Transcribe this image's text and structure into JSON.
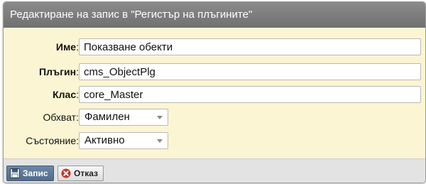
{
  "dialog": {
    "title": "Редактиране на запис в \"Регистър на плъгините\""
  },
  "form": {
    "fields": [
      {
        "label": "Име",
        "value": "Показване обекти"
      },
      {
        "label": "Плъгин",
        "value": "cms_ObjectPlg"
      },
      {
        "label": "Клас",
        "value": "core_Master"
      }
    ],
    "scope": {
      "label": "Обхват",
      "value": "Фамилен"
    },
    "state": {
      "label": "Състояние",
      "value": "Активно"
    }
  },
  "buttons": {
    "save_label": "Запис",
    "cancel_label": "Отказ"
  },
  "icons": {
    "save": "floppy-disk-icon",
    "cancel": "cancel-x-icon"
  },
  "colors": {
    "title_bar": "#7d7d7d",
    "form_background": "#fbf5d3",
    "footer_background": "#e3e3e3",
    "save_button": "#5f7a98",
    "cancel_icon": "#c0392b"
  }
}
